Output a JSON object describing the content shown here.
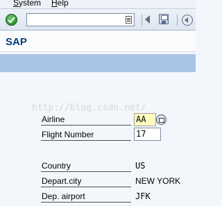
{
  "menu": {
    "items": [
      {
        "label_ul": "S",
        "label_rest": "ystem"
      },
      {
        "label_ul": "H",
        "label_rest": "elp"
      }
    ]
  },
  "toolbar": {
    "command_value": ""
  },
  "screen": {
    "title": "SAP"
  },
  "watermark": "http://blog.csdn.net/",
  "form": {
    "airline_label": "Airline",
    "airline_value": "AA",
    "flight_number_label": "Flight Number",
    "flight_number_value": "17",
    "country_label": "Country",
    "country_value": "US",
    "depart_city_label": "Depart.city",
    "depart_city_value": "NEW YORK",
    "dep_airport_label": "Dep. airport",
    "dep_airport_value": "JFK"
  }
}
